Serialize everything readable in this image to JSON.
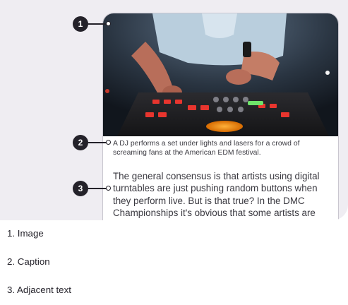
{
  "callouts": [
    {
      "number": "1",
      "legend": "1. Image"
    },
    {
      "number": "2",
      "legend": "2. Caption"
    },
    {
      "number": "3",
      "legend": "3. Adjacent text"
    }
  ],
  "card": {
    "caption": "A DJ performs a set under lights and lasers for a crowd of screaming fans at the American EDM festival.",
    "body": "The general consensus is that artists using digital turntables are just pushing random buttons when they perform live. But is that true? In the DMC Championships it's obvious that some artists are"
  },
  "colors": {
    "stage": "#efedf2",
    "marker": "#24222a",
    "card_border": "#c9c6cf"
  }
}
